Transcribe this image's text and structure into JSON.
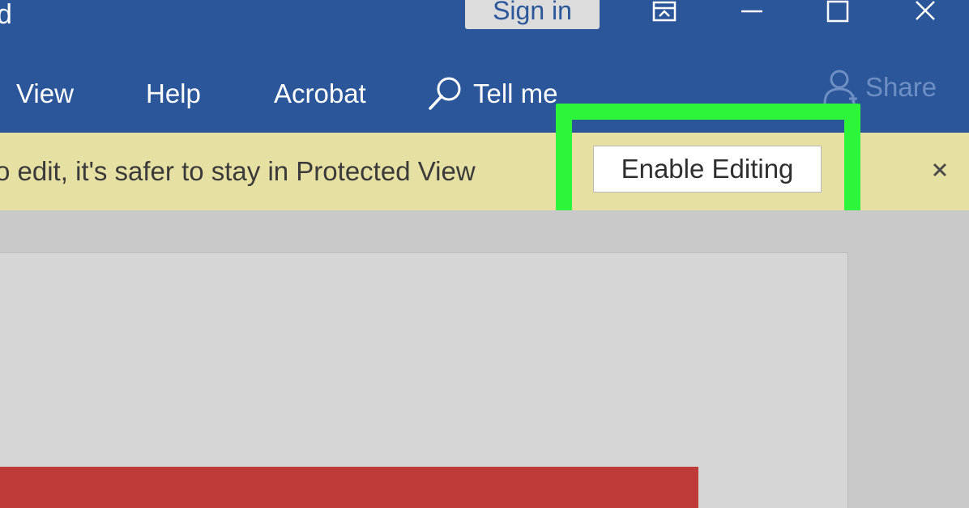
{
  "titlebar": {
    "app_title": "d",
    "signin_label": "Sign in",
    "window_buttons": [
      "ribbon-display-options-icon",
      "minimize-icon",
      "maximize-icon",
      "close-icon"
    ]
  },
  "ribbon": {
    "tabs": [
      {
        "label": "View"
      },
      {
        "label": "Help"
      },
      {
        "label": "Acrobat"
      }
    ],
    "tellme_label": "Tell me",
    "share_label": "Share"
  },
  "message_bar": {
    "text": "o edit, it's safer to stay in Protected View",
    "button_label": "Enable Editing",
    "close_icon": "close-icon"
  },
  "colors": {
    "accent": "#2b579a",
    "message_bar": "#e6e0a3",
    "highlight": "#2df53a",
    "red_block": "#bf3b38"
  }
}
